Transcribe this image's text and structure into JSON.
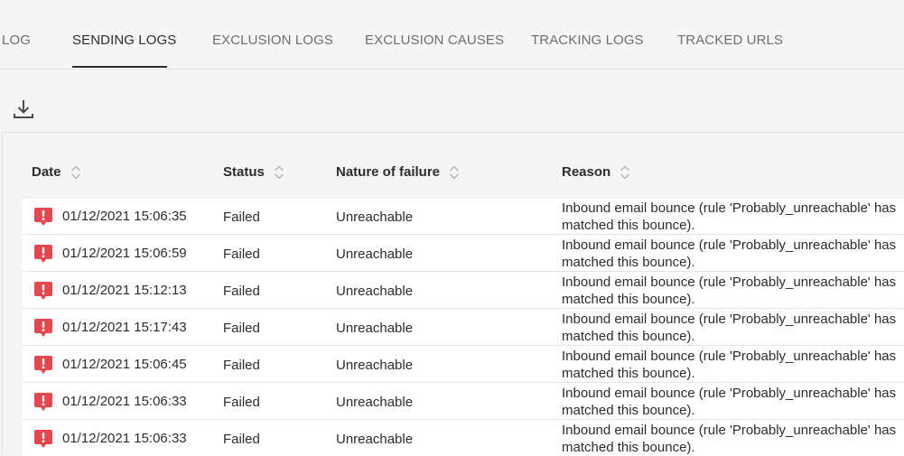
{
  "tabs": [
    {
      "label": "LOG",
      "active": false
    },
    {
      "label": "SENDING LOGS",
      "active": true
    },
    {
      "label": "EXCLUSION LOGS",
      "active": false
    },
    {
      "label": "EXCLUSION CAUSES",
      "active": false
    },
    {
      "label": "TRACKING LOGS",
      "active": false
    },
    {
      "label": "TRACKED URLS",
      "active": false
    }
  ],
  "toolbar": {
    "download_icon": "download-icon"
  },
  "table": {
    "columns": [
      "Date",
      "Status",
      "Nature of failure",
      "Reason"
    ],
    "rows": [
      {
        "date": "01/12/2021 15:06:35",
        "status": "Failed",
        "nature": "Unreachable",
        "reason": "Inbound email bounce (rule 'Probably_unreachable' has matched this bounce)."
      },
      {
        "date": "01/12/2021 15:06:59",
        "status": "Failed",
        "nature": "Unreachable",
        "reason": "Inbound email bounce (rule 'Probably_unreachable' has matched this bounce)."
      },
      {
        "date": "01/12/2021 15:12:13",
        "status": "Failed",
        "nature": "Unreachable",
        "reason": "Inbound email bounce (rule 'Probably_unreachable' has matched this bounce)."
      },
      {
        "date": "01/12/2021 15:17:43",
        "status": "Failed",
        "nature": "Unreachable",
        "reason": "Inbound email bounce (rule 'Probably_unreachable' has matched this bounce)."
      },
      {
        "date": "01/12/2021 15:06:45",
        "status": "Failed",
        "nature": "Unreachable",
        "reason": "Inbound email bounce (rule 'Probably_unreachable' has matched this bounce)."
      },
      {
        "date": "01/12/2021 15:06:33",
        "status": "Failed",
        "nature": "Unreachable",
        "reason": "Inbound email bounce (rule 'Probably_unreachable' has matched this bounce)."
      },
      {
        "date": "01/12/2021 15:06:33",
        "status": "Failed",
        "nature": "Unreachable",
        "reason": "Inbound email bounce (rule 'Probably_unreachable' has matched this bounce)."
      }
    ]
  },
  "colors": {
    "alert": "#e34850",
    "active_tab": "#2c2c2c",
    "inactive_tab": "#6e6e6e"
  }
}
